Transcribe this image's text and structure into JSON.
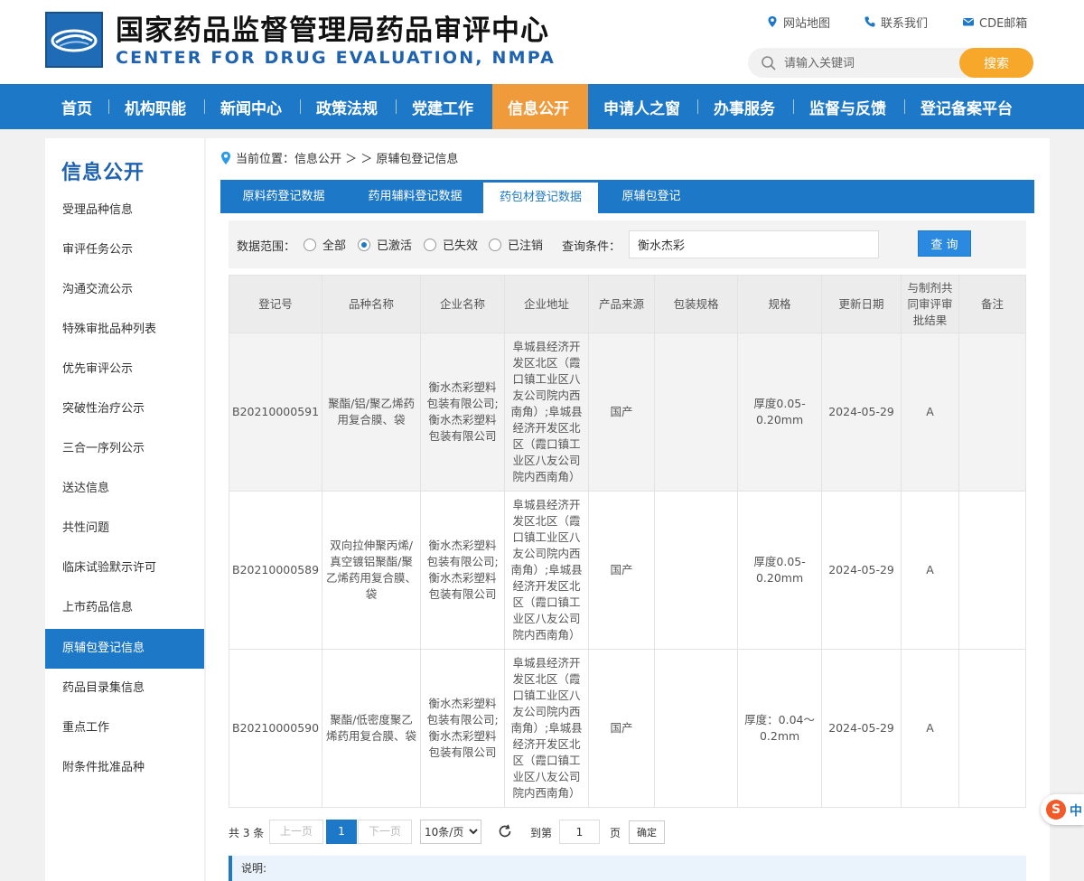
{
  "header": {
    "title": "国家药品监督管理局药品审评中心",
    "subtitle": "CENTER FOR DRUG EVALUATION, NMPA",
    "links": {
      "sitemap": "网站地图",
      "contact": "联系我们",
      "mail": "CDE邮箱"
    },
    "search": {
      "placeholder": "请输入关键词",
      "button": "搜索"
    }
  },
  "nav": {
    "items": [
      "首页",
      "机构职能",
      "新闻中心",
      "政策法规",
      "党建工作",
      "信息公开",
      "申请人之窗",
      "办事服务",
      "监督与反馈",
      "登记备案平台"
    ],
    "active": "信息公开"
  },
  "sidebar": {
    "title": "信息公开",
    "items": [
      "受理品种信息",
      "审评任务公示",
      "沟通交流公示",
      "特殊审批品种列表",
      "优先审评公示",
      "突破性治疗公示",
      "三合一序列公示",
      "送达信息",
      "共性问题",
      "临床试验默示许可",
      "上市药品信息",
      "原辅包登记信息",
      "药品目录集信息",
      "重点工作",
      "附条件批准品种"
    ],
    "active": "原辅包登记信息"
  },
  "breadcrumb": {
    "prefix": "当前位置：",
    "path": "信息公开 ＞ ＞ 原辅包登记信息"
  },
  "tabs": {
    "items": [
      "原料药登记数据",
      "药用辅料登记数据",
      "药包材登记数据",
      "原辅包登记"
    ],
    "active": "药包材登记数据"
  },
  "filter": {
    "scope_label": "数据范围：",
    "options": [
      "全部",
      "已激活",
      "已失效",
      "已注销"
    ],
    "selected": "已激活",
    "query_label": "查询条件：",
    "query_value": "衡水杰彩",
    "query_button": "查 询"
  },
  "table": {
    "headers": [
      "登记号",
      "品种名称",
      "企业名称",
      "企业地址",
      "产品来源",
      "包装规格",
      "规格",
      "更新日期",
      "与制剂共同审评审批结果",
      "备注"
    ],
    "rows": [
      {
        "reg_no": "B20210000591",
        "name": "聚酯/铝/聚乙烯药用复合膜、袋",
        "company": "衡水杰彩塑料包装有限公司;衡水杰彩塑料包装有限公司",
        "address": "阜城县经济开发区北区（霞口镇工业区八友公司院内西南角）;阜城县经济开发区北区（霞口镇工业区八友公司院内西南角）",
        "origin": "国产",
        "package": "",
        "spec": "厚度0.05-0.20mm",
        "date": "2024-05-29",
        "result": "A",
        "remark": ""
      },
      {
        "reg_no": "B20210000589",
        "name": "双向拉伸聚丙烯/真空镀铝聚酯/聚乙烯药用复合膜、袋",
        "company": "衡水杰彩塑料包装有限公司;衡水杰彩塑料包装有限公司",
        "address": "阜城县经济开发区北区（霞口镇工业区八友公司院内西南角）;阜城县经济开发区北区（霞口镇工业区八友公司院内西南角）",
        "origin": "国产",
        "package": "",
        "spec": "厚度0.05-0.20mm",
        "date": "2024-05-29",
        "result": "A",
        "remark": ""
      },
      {
        "reg_no": "B20210000590",
        "name": "聚酯/低密度聚乙烯药用复合膜、袋",
        "company": "衡水杰彩塑料包装有限公司;衡水杰彩塑料包装有限公司",
        "address": "阜城县经济开发区北区（霞口镇工业区八友公司院内西南角）;阜城县经济开发区北区（霞口镇工业区八友公司院内西南角）",
        "origin": "国产",
        "package": "",
        "spec": "厚度：0.04～0.2mm",
        "date": "2024-05-29",
        "result": "A",
        "remark": ""
      }
    ]
  },
  "pager": {
    "total": "共 3 条",
    "prev": "上一页",
    "current": "1",
    "next": "下一页",
    "page_size": "10条/页",
    "goto_label": "到第",
    "goto_value": "1",
    "page_unit": "页",
    "confirm": "确定"
  },
  "note": {
    "label": "说明:"
  },
  "badge": {
    "text": "中"
  },
  "colors": {
    "primary": "#1e78c8",
    "nav_active": "#ef9a3b",
    "search_button": "#f7a82a",
    "title_blue": "#1f63b0"
  }
}
